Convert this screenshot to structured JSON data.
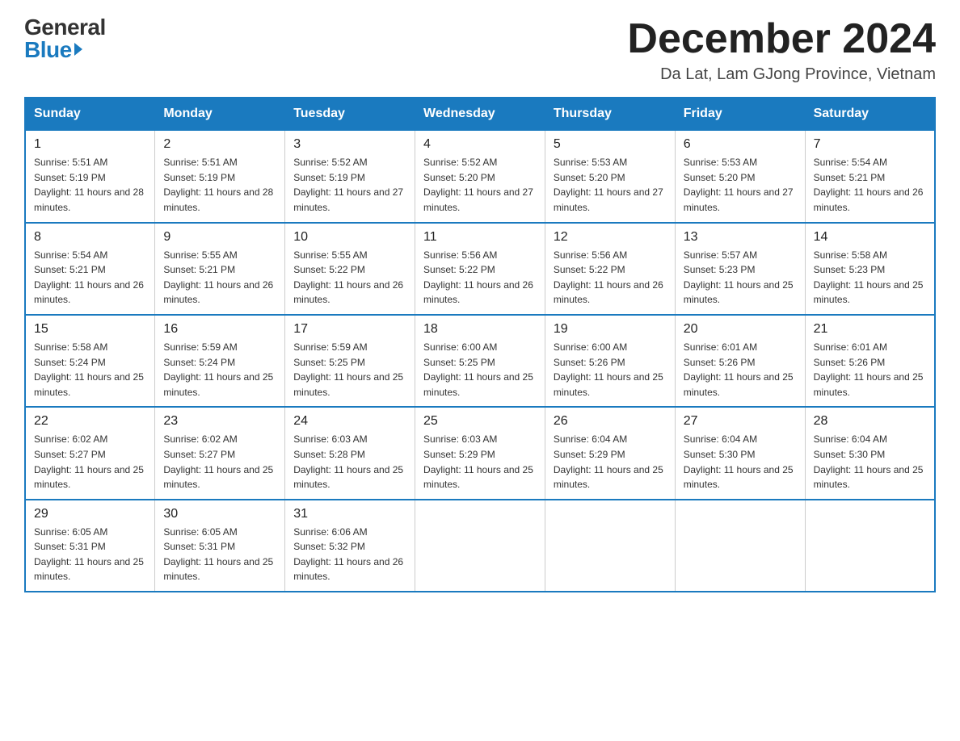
{
  "header": {
    "logo_general": "General",
    "logo_blue": "Blue",
    "month_title": "December 2024",
    "location": "Da Lat, Lam GJong Province, Vietnam"
  },
  "days_of_week": [
    "Sunday",
    "Monday",
    "Tuesday",
    "Wednesday",
    "Thursday",
    "Friday",
    "Saturday"
  ],
  "weeks": [
    [
      {
        "day": "1",
        "sunrise": "5:51 AM",
        "sunset": "5:19 PM",
        "daylight": "11 hours and 28 minutes."
      },
      {
        "day": "2",
        "sunrise": "5:51 AM",
        "sunset": "5:19 PM",
        "daylight": "11 hours and 28 minutes."
      },
      {
        "day": "3",
        "sunrise": "5:52 AM",
        "sunset": "5:19 PM",
        "daylight": "11 hours and 27 minutes."
      },
      {
        "day": "4",
        "sunrise": "5:52 AM",
        "sunset": "5:20 PM",
        "daylight": "11 hours and 27 minutes."
      },
      {
        "day": "5",
        "sunrise": "5:53 AM",
        "sunset": "5:20 PM",
        "daylight": "11 hours and 27 minutes."
      },
      {
        "day": "6",
        "sunrise": "5:53 AM",
        "sunset": "5:20 PM",
        "daylight": "11 hours and 27 minutes."
      },
      {
        "day": "7",
        "sunrise": "5:54 AM",
        "sunset": "5:21 PM",
        "daylight": "11 hours and 26 minutes."
      }
    ],
    [
      {
        "day": "8",
        "sunrise": "5:54 AM",
        "sunset": "5:21 PM",
        "daylight": "11 hours and 26 minutes."
      },
      {
        "day": "9",
        "sunrise": "5:55 AM",
        "sunset": "5:21 PM",
        "daylight": "11 hours and 26 minutes."
      },
      {
        "day": "10",
        "sunrise": "5:55 AM",
        "sunset": "5:22 PM",
        "daylight": "11 hours and 26 minutes."
      },
      {
        "day": "11",
        "sunrise": "5:56 AM",
        "sunset": "5:22 PM",
        "daylight": "11 hours and 26 minutes."
      },
      {
        "day": "12",
        "sunrise": "5:56 AM",
        "sunset": "5:22 PM",
        "daylight": "11 hours and 26 minutes."
      },
      {
        "day": "13",
        "sunrise": "5:57 AM",
        "sunset": "5:23 PM",
        "daylight": "11 hours and 25 minutes."
      },
      {
        "day": "14",
        "sunrise": "5:58 AM",
        "sunset": "5:23 PM",
        "daylight": "11 hours and 25 minutes."
      }
    ],
    [
      {
        "day": "15",
        "sunrise": "5:58 AM",
        "sunset": "5:24 PM",
        "daylight": "11 hours and 25 minutes."
      },
      {
        "day": "16",
        "sunrise": "5:59 AM",
        "sunset": "5:24 PM",
        "daylight": "11 hours and 25 minutes."
      },
      {
        "day": "17",
        "sunrise": "5:59 AM",
        "sunset": "5:25 PM",
        "daylight": "11 hours and 25 minutes."
      },
      {
        "day": "18",
        "sunrise": "6:00 AM",
        "sunset": "5:25 PM",
        "daylight": "11 hours and 25 minutes."
      },
      {
        "day": "19",
        "sunrise": "6:00 AM",
        "sunset": "5:26 PM",
        "daylight": "11 hours and 25 minutes."
      },
      {
        "day": "20",
        "sunrise": "6:01 AM",
        "sunset": "5:26 PM",
        "daylight": "11 hours and 25 minutes."
      },
      {
        "day": "21",
        "sunrise": "6:01 AM",
        "sunset": "5:26 PM",
        "daylight": "11 hours and 25 minutes."
      }
    ],
    [
      {
        "day": "22",
        "sunrise": "6:02 AM",
        "sunset": "5:27 PM",
        "daylight": "11 hours and 25 minutes."
      },
      {
        "day": "23",
        "sunrise": "6:02 AM",
        "sunset": "5:27 PM",
        "daylight": "11 hours and 25 minutes."
      },
      {
        "day": "24",
        "sunrise": "6:03 AM",
        "sunset": "5:28 PM",
        "daylight": "11 hours and 25 minutes."
      },
      {
        "day": "25",
        "sunrise": "6:03 AM",
        "sunset": "5:29 PM",
        "daylight": "11 hours and 25 minutes."
      },
      {
        "day": "26",
        "sunrise": "6:04 AM",
        "sunset": "5:29 PM",
        "daylight": "11 hours and 25 minutes."
      },
      {
        "day": "27",
        "sunrise": "6:04 AM",
        "sunset": "5:30 PM",
        "daylight": "11 hours and 25 minutes."
      },
      {
        "day": "28",
        "sunrise": "6:04 AM",
        "sunset": "5:30 PM",
        "daylight": "11 hours and 25 minutes."
      }
    ],
    [
      {
        "day": "29",
        "sunrise": "6:05 AM",
        "sunset": "5:31 PM",
        "daylight": "11 hours and 25 minutes."
      },
      {
        "day": "30",
        "sunrise": "6:05 AM",
        "sunset": "5:31 PM",
        "daylight": "11 hours and 25 minutes."
      },
      {
        "day": "31",
        "sunrise": "6:06 AM",
        "sunset": "5:32 PM",
        "daylight": "11 hours and 26 minutes."
      },
      null,
      null,
      null,
      null
    ]
  ]
}
